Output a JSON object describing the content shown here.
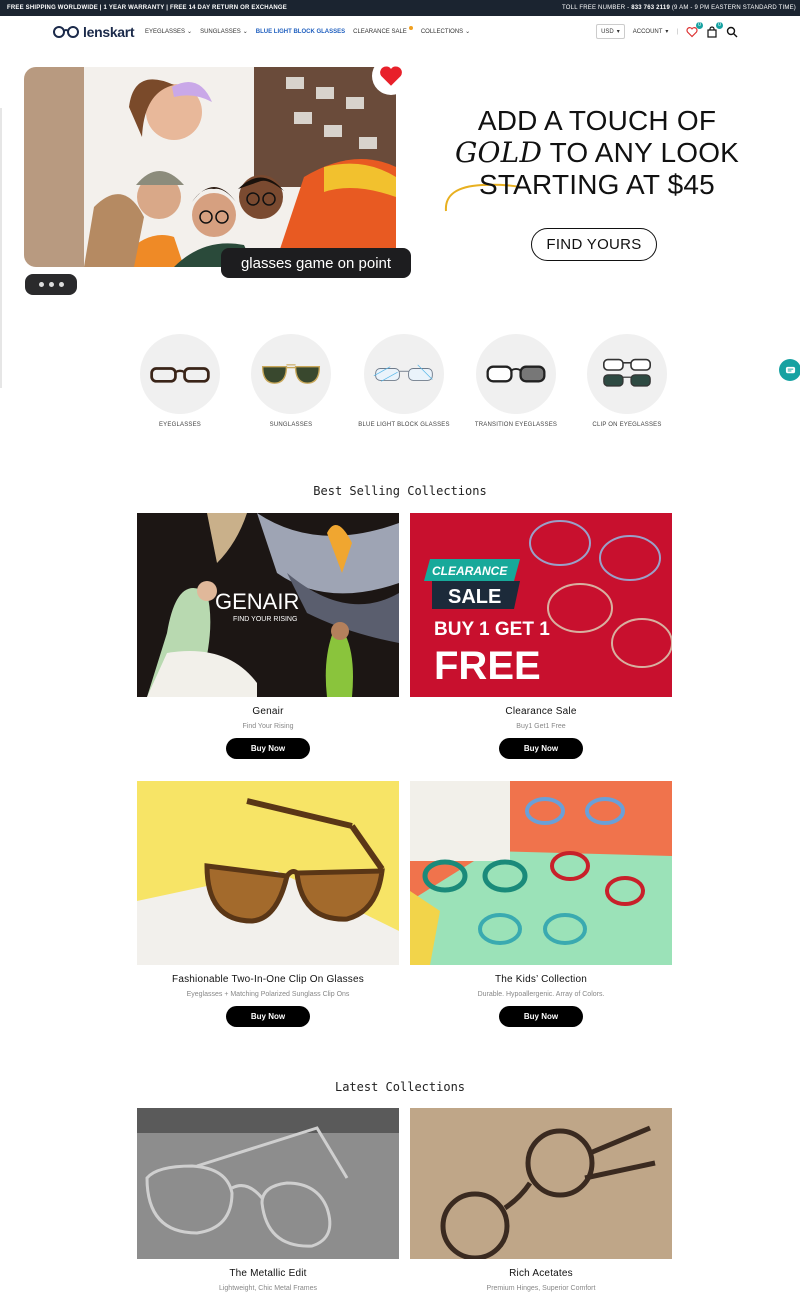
{
  "announcement": {
    "left": "FREE SHIPPING WORLDWIDE | 1 YEAR WARRANTY | FREE 14 DAY RETURN OR EXCHANGE",
    "right_prefix": "TOLL FREE NUMBER -",
    "phone": "833 763 2119",
    "hours": "(9 AM - 9 PM EASTERN STANDARD TIME)"
  },
  "header": {
    "logo_text": "lenskart",
    "nav": [
      {
        "label": "EYEGLASSES",
        "chevron": true
      },
      {
        "label": "SUNGLASSES",
        "chevron": true
      },
      {
        "label": "BLUE LIGHT BLOCK GLASSES",
        "chevron": false
      },
      {
        "label": "CLEARANCE SALE",
        "chevron": false
      },
      {
        "label": "COLLECTIONS",
        "chevron": true
      }
    ],
    "currency": "USD",
    "account": "ACCOUNT",
    "wishlist_count": "0",
    "cart_count": "0",
    "icons": [
      "heart-icon",
      "bag-icon",
      "search-icon"
    ]
  },
  "hero": {
    "caption": "glasses game on point",
    "headline_line1": "ADD A TOUCH OF",
    "headline_gold": "GOLD",
    "headline_line2_rest": " TO ANY LOOK",
    "headline_line3": "STARTING AT $45",
    "cta": "FIND YOURS",
    "accent_color": "#e8b020"
  },
  "categories": [
    {
      "label": "EYEGLASSES",
      "icon": "eyeglasses-icon"
    },
    {
      "label": "SUNGLASSES",
      "icon": "sunglasses-icon"
    },
    {
      "label": "BLUE LIGHT BLOCK GLASSES",
      "icon": "blue-light-glasses-icon"
    },
    {
      "label": "TRANSITION EYEGLASSES",
      "icon": "transition-glasses-icon"
    },
    {
      "label": "CLIP ON EYEGLASSES",
      "icon": "clip-on-glasses-icon"
    }
  ],
  "best_selling": {
    "title": "Best Selling Collections",
    "items": [
      {
        "title": "Genair",
        "subtitle": "Find Your Rising",
        "button": "Buy Now",
        "art_title": "GENAIR",
        "art_sub": "FIND YOUR RISING"
      },
      {
        "title": "Clearance Sale",
        "subtitle": "Buy1 Get1 Free",
        "button": "Buy Now",
        "art_tag": "CLEARANCE",
        "art_sale": "SALE",
        "art_line1": "BUY 1 GET 1",
        "art_line2": "FREE"
      },
      {
        "title": "Fashionable Two-In-One Clip On Glasses",
        "subtitle": "Eyeglasses + Matching Polarized Sunglass Clip Ons",
        "button": "Buy Now"
      },
      {
        "title": "The Kids’ Collection",
        "subtitle": "Durable. Hypoallergenic. Array of Colors.",
        "button": "Buy Now"
      }
    ]
  },
  "latest": {
    "title": "Latest Collections",
    "items": [
      {
        "title": "The Metallic Edit",
        "subtitle": "Lightweight, Chic Metal Frames"
      },
      {
        "title": "Rich Acetates",
        "subtitle": "Premium Hinges, Superior Comfort"
      }
    ]
  }
}
